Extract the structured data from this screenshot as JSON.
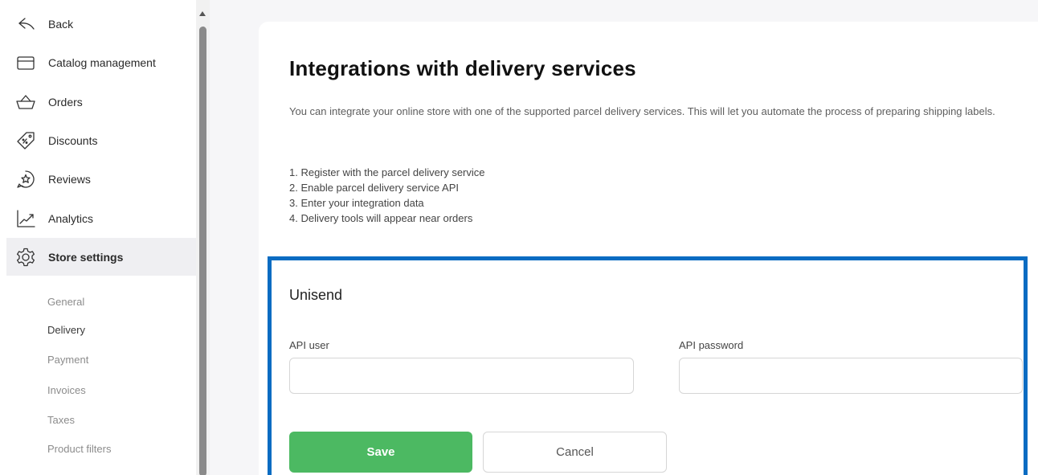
{
  "sidebar": {
    "items": [
      {
        "label": "Back",
        "icon": "back-arrow-icon"
      },
      {
        "label": "Catalog management",
        "icon": "folder-icon"
      },
      {
        "label": "Orders",
        "icon": "basket-icon"
      },
      {
        "label": "Discounts",
        "icon": "discount-tag-icon"
      },
      {
        "label": "Reviews",
        "icon": "star-bubble-icon"
      },
      {
        "label": "Analytics",
        "icon": "chart-trend-icon"
      },
      {
        "label": "Store settings",
        "icon": "gear-icon"
      }
    ],
    "subitems": [
      {
        "label": "General"
      },
      {
        "label": "Delivery"
      },
      {
        "label": "Payment"
      },
      {
        "label": "Invoices"
      },
      {
        "label": "Taxes"
      },
      {
        "label": "Product filters"
      }
    ]
  },
  "main": {
    "title": "Integrations with delivery services",
    "intro": "You can integrate your online store with one of the supported parcel delivery services. This will let you automate the process of preparing shipping labels.",
    "steps": [
      "1. Register with the parcel delivery service",
      "2. Enable parcel delivery service API",
      "3. Enter your integration data",
      "4. Delivery tools will appear near orders"
    ]
  },
  "integration": {
    "title": "Unisend",
    "api_user_label": "API user",
    "api_user_value": "",
    "api_password_label": "API password",
    "api_password_value": "",
    "save_label": "Save",
    "cancel_label": "Cancel"
  },
  "colors": {
    "accent_green": "#4cb962",
    "panel_border_blue": "#0a6cc2",
    "active_nav_bg": "#efeff2"
  }
}
